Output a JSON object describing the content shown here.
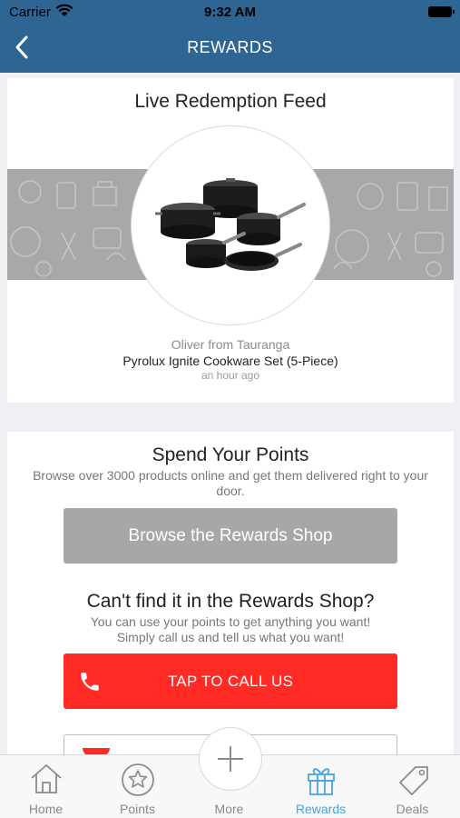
{
  "status_bar": {
    "carrier": "Carrier",
    "time": "9:32 AM"
  },
  "nav": {
    "title": "REWARDS",
    "back_icon": "chevron-left-icon"
  },
  "feed": {
    "title": "Live Redemption Feed",
    "redeemer": "Oliver from Tauranga",
    "product": "Pyrolux Ignite Cookware Set (5-Piece)",
    "time_ago": "an hour ago"
  },
  "spend": {
    "title": "Spend Your Points",
    "description": "Browse over 3000 products online and get them delivered right to your door.",
    "shop_button": "Browse the Rewards Shop"
  },
  "cant_find": {
    "title": "Can't find it in the Rewards Shop?",
    "line1": "You can use your points to get anything you want!",
    "line2": "Simply call us and tell us what you want!",
    "call_button": "TAP TO CALL US",
    "call_icon": "phone-icon"
  },
  "tabs": [
    {
      "label": "Home",
      "icon": "home-icon",
      "active": false
    },
    {
      "label": "Points",
      "icon": "star-icon",
      "active": false
    },
    {
      "label": "More",
      "icon": "plus-icon",
      "active": false
    },
    {
      "label": "Rewards",
      "icon": "gift-icon",
      "active": true
    },
    {
      "label": "Deals",
      "icon": "tag-icon",
      "active": false
    }
  ],
  "colors": {
    "nav_bar": "#2f6593",
    "call_button": "#ff2b24",
    "shop_button": "#a7a7a7",
    "active_tab": "#4aa3df",
    "inactive_tab": "#8a8a8a"
  }
}
